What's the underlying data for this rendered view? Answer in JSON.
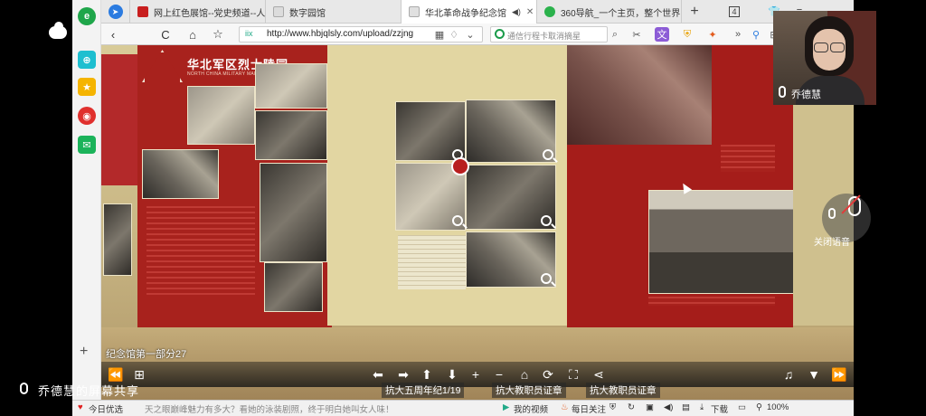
{
  "browser": {
    "tabs": [
      {
        "label": "网上红色展馆--党史频道--人民",
        "favicon_color": "#c81e1e",
        "active": false
      },
      {
        "label": "数字园馆",
        "favicon_color": "#dcdcdc",
        "active": false
      },
      {
        "label": "华北革命战争纪念馆",
        "favicon_color": "#e0e0e0",
        "active": true
      },
      {
        "label": "360导航_一个主页，整个世界",
        "favicon_color": "#2bb24c",
        "active": false
      }
    ],
    "tab_count": "4",
    "url": "http://www.hbjqlsly.com/upload/zzjng",
    "url_prefix": "iix",
    "search_placeholder": "通信行程卡取消摘星",
    "back_label": "‹",
    "reload_label": "C",
    "home_label": "⌂",
    "star_label": "☆"
  },
  "viewer": {
    "logo_title": "华北军区烈士陵园",
    "logo_subtitle": "NORTH CHINA MILITARY MARTYRS CEMETERY",
    "scene_caption": "纪念馆第一部分27",
    "bottom_labels": [
      "抗大五周年纪1/19",
      "抗大教职员证章",
      "抗大教职员证章"
    ]
  },
  "statusbar": {
    "left_badge": "今日优选",
    "news_text": "天之眼巅峰魅力有多大？看她的泳装剧照，终于明白她叫女人味！",
    "video_label": "我的视频",
    "follow_label": "每日关注",
    "download_label": "下载",
    "zoom": "100%"
  },
  "meeting": {
    "participant_name": "乔德慧",
    "mute_label": "关闭语音",
    "share_label": "乔德慧的屏幕共享"
  },
  "colors": {
    "panel_red": "#a8221d",
    "wall": "#d8cb98"
  }
}
